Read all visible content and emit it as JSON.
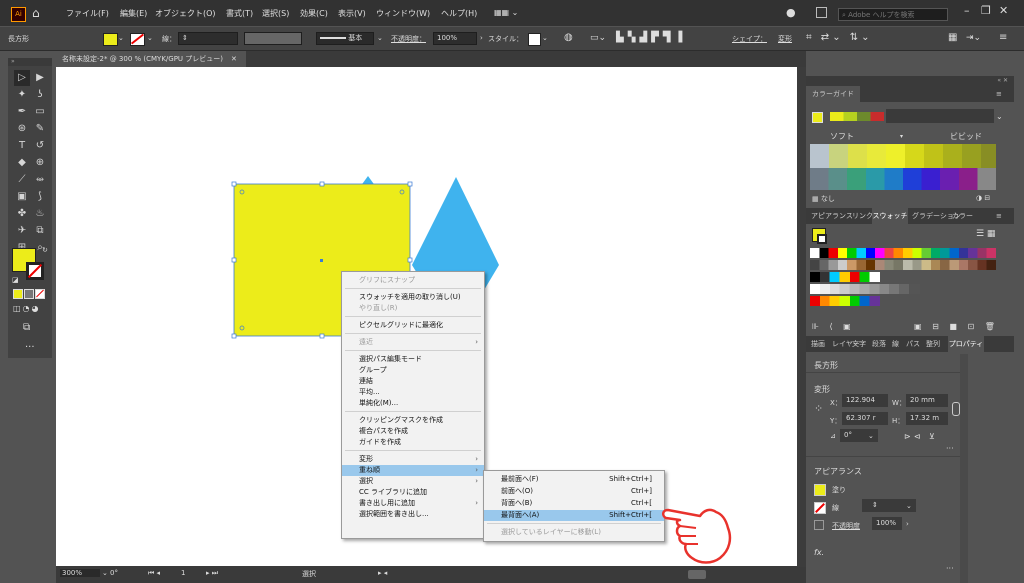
{
  "menubar": {
    "logo": "Ai",
    "items": [
      "ファイル(F)",
      "編集(E)",
      "オブジェクト(O)",
      "書式(T)",
      "選択(S)",
      "効果(C)",
      "表示(V)",
      "ウィンドウ(W)",
      "ヘルプ(H)"
    ],
    "search_placeholder": "Adobe ヘルプを検索"
  },
  "controlbar": {
    "object_type": "長方形",
    "stroke_label": "線：",
    "stroke_style": "基本",
    "opacity_label": "不透明度：",
    "opacity_value": "100%",
    "style_label": "スタイル：",
    "shape_label": "シェイプ：",
    "transform_label": "変形"
  },
  "document": {
    "tab_title": "名称未設定-2* @ 300 % (CMYK/GPU プレビュー)"
  },
  "statusbar": {
    "zoom": "300%",
    "rotation": "0°",
    "page": "1",
    "tool": "選択"
  },
  "context_menu": {
    "items": [
      {
        "label": "グリフにスナップ",
        "disabled": true
      },
      {
        "label": "スウォッチを適用の取り消し(U)",
        "disabled": false
      },
      {
        "label": "やり直し(R)",
        "disabled": true
      },
      {
        "label": "ピクセルグリッドに最適化",
        "disabled": false
      },
      {
        "label": "遠近",
        "disabled": true,
        "submenu": true
      },
      {
        "label": "選択パス編集モード",
        "disabled": false
      },
      {
        "label": "グループ",
        "disabled": false
      },
      {
        "label": "連結",
        "disabled": false
      },
      {
        "label": "平均...",
        "disabled": false
      },
      {
        "label": "単純化(M)...",
        "disabled": false
      },
      {
        "label": "クリッピングマスクを作成",
        "disabled": false
      },
      {
        "label": "複合パスを作成",
        "disabled": false
      },
      {
        "label": "ガイドを作成",
        "disabled": false
      },
      {
        "label": "変形",
        "disabled": false,
        "submenu": true
      },
      {
        "label": "重ね順",
        "disabled": false,
        "submenu": true,
        "highlighted": true
      },
      {
        "label": "選択",
        "disabled": false,
        "submenu": true
      },
      {
        "label": "CC ライブラリに追加",
        "disabled": false
      },
      {
        "label": "書き出し用に追加",
        "disabled": false,
        "submenu": true
      },
      {
        "label": "選択範囲を書き出し...",
        "disabled": false
      }
    ]
  },
  "submenu": {
    "items": [
      {
        "label": "最前面へ(F)",
        "shortcut": "Shift+Ctrl+]"
      },
      {
        "label": "前面へ(O)",
        "shortcut": "Ctrl+]"
      },
      {
        "label": "背面へ(B)",
        "shortcut": "Ctrl+["
      },
      {
        "label": "最背面へ(A)",
        "shortcut": "Shift+Ctrl+[",
        "highlighted": true
      },
      {
        "label": "選択しているレイヤーに移動(L)",
        "shortcut": "",
        "disabled": true
      }
    ]
  },
  "color_guide": {
    "tab": "カラーガイド",
    "soft_label": "ソフト",
    "vivid_label": "ビビッド",
    "none_label": "なし"
  },
  "swatches_panel": {
    "tabs": [
      "アピアランス",
      "リンク",
      "スウォッチ",
      "グラデーション",
      "カラー"
    ]
  },
  "properties_panel": {
    "tabs": [
      "描画",
      "レイヤー",
      "文字",
      "段落",
      "線",
      "パス",
      "整列",
      "プロパティ"
    ],
    "object_label": "長方形",
    "transform_label": "変形",
    "x_label": "X：",
    "x_value": "122.904",
    "y_label": "Y：",
    "y_value": "62.307 r",
    "w_label": "W：",
    "w_value": "20 mm",
    "h_label": "H：",
    "h_value": "17.32 m",
    "angle_value": "0°",
    "appearance_label": "アピアランス",
    "fill_label": "塗り",
    "stroke_label": "線",
    "opacity_label": "不透明度",
    "opacity_value": "100%",
    "fx_label": "fx."
  },
  "colors": {
    "fill_yellow": "#ecec1a",
    "diamond_blue": "#3fb3ee",
    "menu_highlight": "#99c8ec",
    "ai_orange": "#ff9a00",
    "hand_red": "#e8322c"
  }
}
